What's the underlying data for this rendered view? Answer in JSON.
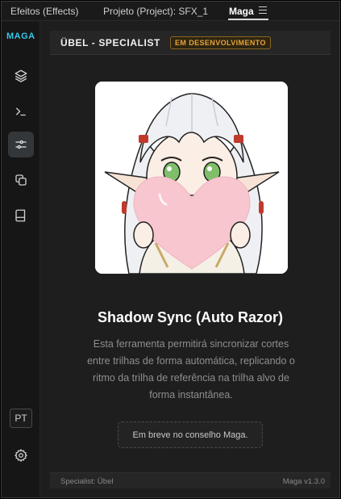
{
  "tabs": [
    {
      "label": "Efeitos (Effects)"
    },
    {
      "label": "Projeto (Project): SFX_1"
    },
    {
      "label": "Maga"
    }
  ],
  "sidebar": {
    "brand": "MAGA",
    "items": [
      {
        "icon": "layers-icon"
      },
      {
        "icon": "terminal-icon"
      },
      {
        "icon": "sliders-icon",
        "active": true
      },
      {
        "icon": "copy-icon"
      },
      {
        "icon": "book-icon"
      }
    ],
    "language": "PT",
    "settings_icon": "gear-icon"
  },
  "header": {
    "title": "ÜBEL - SPECIALIST",
    "badge": "EM DESENVOLVIMENTO"
  },
  "tool": {
    "title": "Shadow Sync (Auto Razor)",
    "description": "Esta ferramenta permitirá sincronizar cortes entre trilhas de forma automática, replicando o ritmo da trilha de referência na trilha alvo de forma instantânea.",
    "button_label": "Em breve no conselho Maga."
  },
  "footer": {
    "left": "Specialist: Übel",
    "right": "Maga v1.3.0"
  },
  "colors": {
    "accent": "#35c6e8",
    "badge": "#e6a23c",
    "background": "#1e1e1e"
  }
}
